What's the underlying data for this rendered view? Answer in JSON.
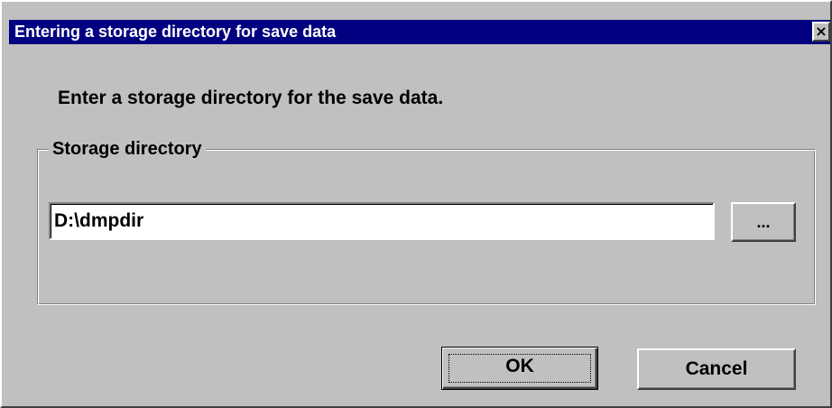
{
  "window": {
    "title": "Entering a storage directory for save data",
    "close_label": "×"
  },
  "prompt": "Enter a storage directory for the save data.",
  "storage_group": {
    "label": "Storage directory",
    "path_value": "D:\\dmpdir",
    "browse_label": "..."
  },
  "buttons": {
    "ok_label": "OK",
    "cancel_label": "Cancel"
  },
  "colors": {
    "titlebar": "#000080",
    "face": "#c0c0c0"
  }
}
